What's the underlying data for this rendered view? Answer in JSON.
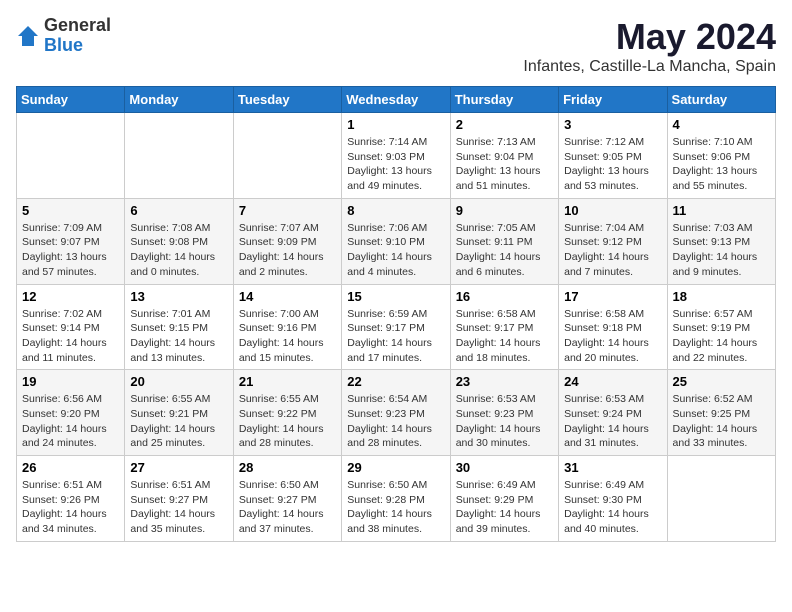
{
  "logo": {
    "general": "General",
    "blue": "Blue"
  },
  "header": {
    "month": "May 2024",
    "location": "Infantes, Castille-La Mancha, Spain"
  },
  "days_of_week": [
    "Sunday",
    "Monday",
    "Tuesday",
    "Wednesday",
    "Thursday",
    "Friday",
    "Saturday"
  ],
  "weeks": [
    [
      {
        "day": "",
        "info": ""
      },
      {
        "day": "",
        "info": ""
      },
      {
        "day": "",
        "info": ""
      },
      {
        "day": "1",
        "info": "Sunrise: 7:14 AM\nSunset: 9:03 PM\nDaylight: 13 hours\nand 49 minutes."
      },
      {
        "day": "2",
        "info": "Sunrise: 7:13 AM\nSunset: 9:04 PM\nDaylight: 13 hours\nand 51 minutes."
      },
      {
        "day": "3",
        "info": "Sunrise: 7:12 AM\nSunset: 9:05 PM\nDaylight: 13 hours\nand 53 minutes."
      },
      {
        "day": "4",
        "info": "Sunrise: 7:10 AM\nSunset: 9:06 PM\nDaylight: 13 hours\nand 55 minutes."
      }
    ],
    [
      {
        "day": "5",
        "info": "Sunrise: 7:09 AM\nSunset: 9:07 PM\nDaylight: 13 hours\nand 57 minutes."
      },
      {
        "day": "6",
        "info": "Sunrise: 7:08 AM\nSunset: 9:08 PM\nDaylight: 14 hours\nand 0 minutes."
      },
      {
        "day": "7",
        "info": "Sunrise: 7:07 AM\nSunset: 9:09 PM\nDaylight: 14 hours\nand 2 minutes."
      },
      {
        "day": "8",
        "info": "Sunrise: 7:06 AM\nSunset: 9:10 PM\nDaylight: 14 hours\nand 4 minutes."
      },
      {
        "day": "9",
        "info": "Sunrise: 7:05 AM\nSunset: 9:11 PM\nDaylight: 14 hours\nand 6 minutes."
      },
      {
        "day": "10",
        "info": "Sunrise: 7:04 AM\nSunset: 9:12 PM\nDaylight: 14 hours\nand 7 minutes."
      },
      {
        "day": "11",
        "info": "Sunrise: 7:03 AM\nSunset: 9:13 PM\nDaylight: 14 hours\nand 9 minutes."
      }
    ],
    [
      {
        "day": "12",
        "info": "Sunrise: 7:02 AM\nSunset: 9:14 PM\nDaylight: 14 hours\nand 11 minutes."
      },
      {
        "day": "13",
        "info": "Sunrise: 7:01 AM\nSunset: 9:15 PM\nDaylight: 14 hours\nand 13 minutes."
      },
      {
        "day": "14",
        "info": "Sunrise: 7:00 AM\nSunset: 9:16 PM\nDaylight: 14 hours\nand 15 minutes."
      },
      {
        "day": "15",
        "info": "Sunrise: 6:59 AM\nSunset: 9:17 PM\nDaylight: 14 hours\nand 17 minutes."
      },
      {
        "day": "16",
        "info": "Sunrise: 6:58 AM\nSunset: 9:17 PM\nDaylight: 14 hours\nand 18 minutes."
      },
      {
        "day": "17",
        "info": "Sunrise: 6:58 AM\nSunset: 9:18 PM\nDaylight: 14 hours\nand 20 minutes."
      },
      {
        "day": "18",
        "info": "Sunrise: 6:57 AM\nSunset: 9:19 PM\nDaylight: 14 hours\nand 22 minutes."
      }
    ],
    [
      {
        "day": "19",
        "info": "Sunrise: 6:56 AM\nSunset: 9:20 PM\nDaylight: 14 hours\nand 24 minutes."
      },
      {
        "day": "20",
        "info": "Sunrise: 6:55 AM\nSunset: 9:21 PM\nDaylight: 14 hours\nand 25 minutes."
      },
      {
        "day": "21",
        "info": "Sunrise: 6:55 AM\nSunset: 9:22 PM\nDaylight: 14 hours\nand 28 minutes."
      },
      {
        "day": "22",
        "info": "Sunrise: 6:54 AM\nSunset: 9:23 PM\nDaylight: 14 hours\nand 28 minutes."
      },
      {
        "day": "23",
        "info": "Sunrise: 6:53 AM\nSunset: 9:23 PM\nDaylight: 14 hours\nand 30 minutes."
      },
      {
        "day": "24",
        "info": "Sunrise: 6:53 AM\nSunset: 9:24 PM\nDaylight: 14 hours\nand 31 minutes."
      },
      {
        "day": "25",
        "info": "Sunrise: 6:52 AM\nSunset: 9:25 PM\nDaylight: 14 hours\nand 33 minutes."
      }
    ],
    [
      {
        "day": "26",
        "info": "Sunrise: 6:51 AM\nSunset: 9:26 PM\nDaylight: 14 hours\nand 34 minutes."
      },
      {
        "day": "27",
        "info": "Sunrise: 6:51 AM\nSunset: 9:27 PM\nDaylight: 14 hours\nand 35 minutes."
      },
      {
        "day": "28",
        "info": "Sunrise: 6:50 AM\nSunset: 9:27 PM\nDaylight: 14 hours\nand 37 minutes."
      },
      {
        "day": "29",
        "info": "Sunrise: 6:50 AM\nSunset: 9:28 PM\nDaylight: 14 hours\nand 38 minutes."
      },
      {
        "day": "30",
        "info": "Sunrise: 6:49 AM\nSunset: 9:29 PM\nDaylight: 14 hours\nand 39 minutes."
      },
      {
        "day": "31",
        "info": "Sunrise: 6:49 AM\nSunset: 9:30 PM\nDaylight: 14 hours\nand 40 minutes."
      },
      {
        "day": "",
        "info": ""
      }
    ]
  ]
}
